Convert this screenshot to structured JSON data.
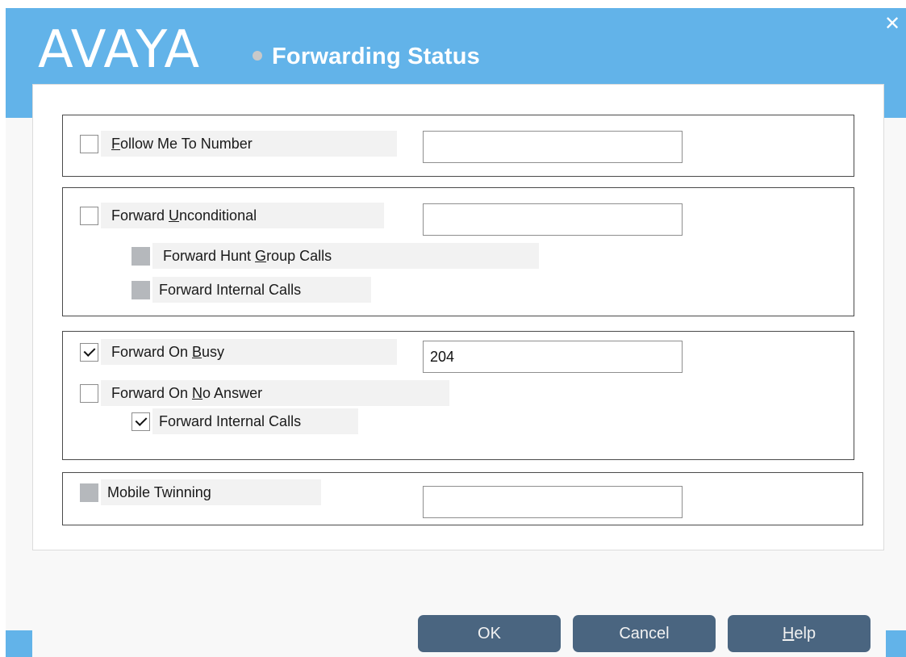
{
  "dialog": {
    "logo": "AVAYA",
    "title": "Forwarding Status",
    "close_icon": "close-icon"
  },
  "follow_me": {
    "label": "Follow Me To Number",
    "mnemonic": "F",
    "checked": false,
    "number_value": ""
  },
  "forward_unconditional": {
    "label": "Forward Unconditional",
    "mnemonic": "U",
    "checked": false,
    "number_value": "",
    "hunt_group": {
      "label": "Forward Hunt Group Calls",
      "mnemonic": "G",
      "checked": false,
      "enabled": false
    },
    "internal": {
      "label": "Forward Internal Calls",
      "checked": false,
      "enabled": false
    }
  },
  "forward_busy": {
    "label": "Forward On Busy",
    "mnemonic": "B",
    "checked": true,
    "number_value": "204"
  },
  "forward_no_answer": {
    "label": "Forward On No Answer",
    "mnemonic": "N",
    "checked": false,
    "internal": {
      "label": "Forward Internal Calls",
      "checked": true
    }
  },
  "mobile_twinning": {
    "label": "Mobile Twinning",
    "checked": false,
    "enabled": false,
    "number_value": ""
  },
  "buttons": {
    "ok": "OK",
    "cancel": "Cancel",
    "help": "Help",
    "help_mnemonic": "H"
  },
  "colors": {
    "header_blue": "#62b3e9",
    "button": "#4a6580",
    "disabled_checkbox": "#b5b8bc"
  }
}
